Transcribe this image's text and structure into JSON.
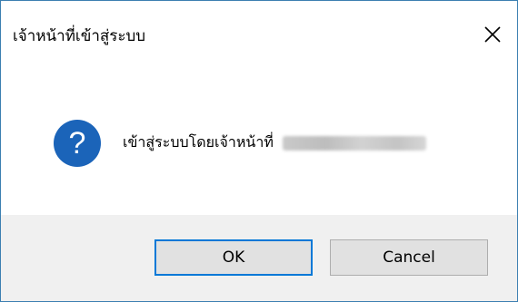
{
  "window": {
    "title": "เจ้าหน้าที่เข้าสู่ระบบ",
    "close_icon": "close-icon"
  },
  "content": {
    "icon": "question-icon",
    "message": "เข้าสู่ระบบโดยเจ้าหน้าที่"
  },
  "buttons": {
    "ok_label": "OK",
    "cancel_label": "Cancel"
  },
  "colors": {
    "accent": "#0078d7",
    "icon_blue": "#1b64b9",
    "footer_bg": "#f0f0f0"
  }
}
